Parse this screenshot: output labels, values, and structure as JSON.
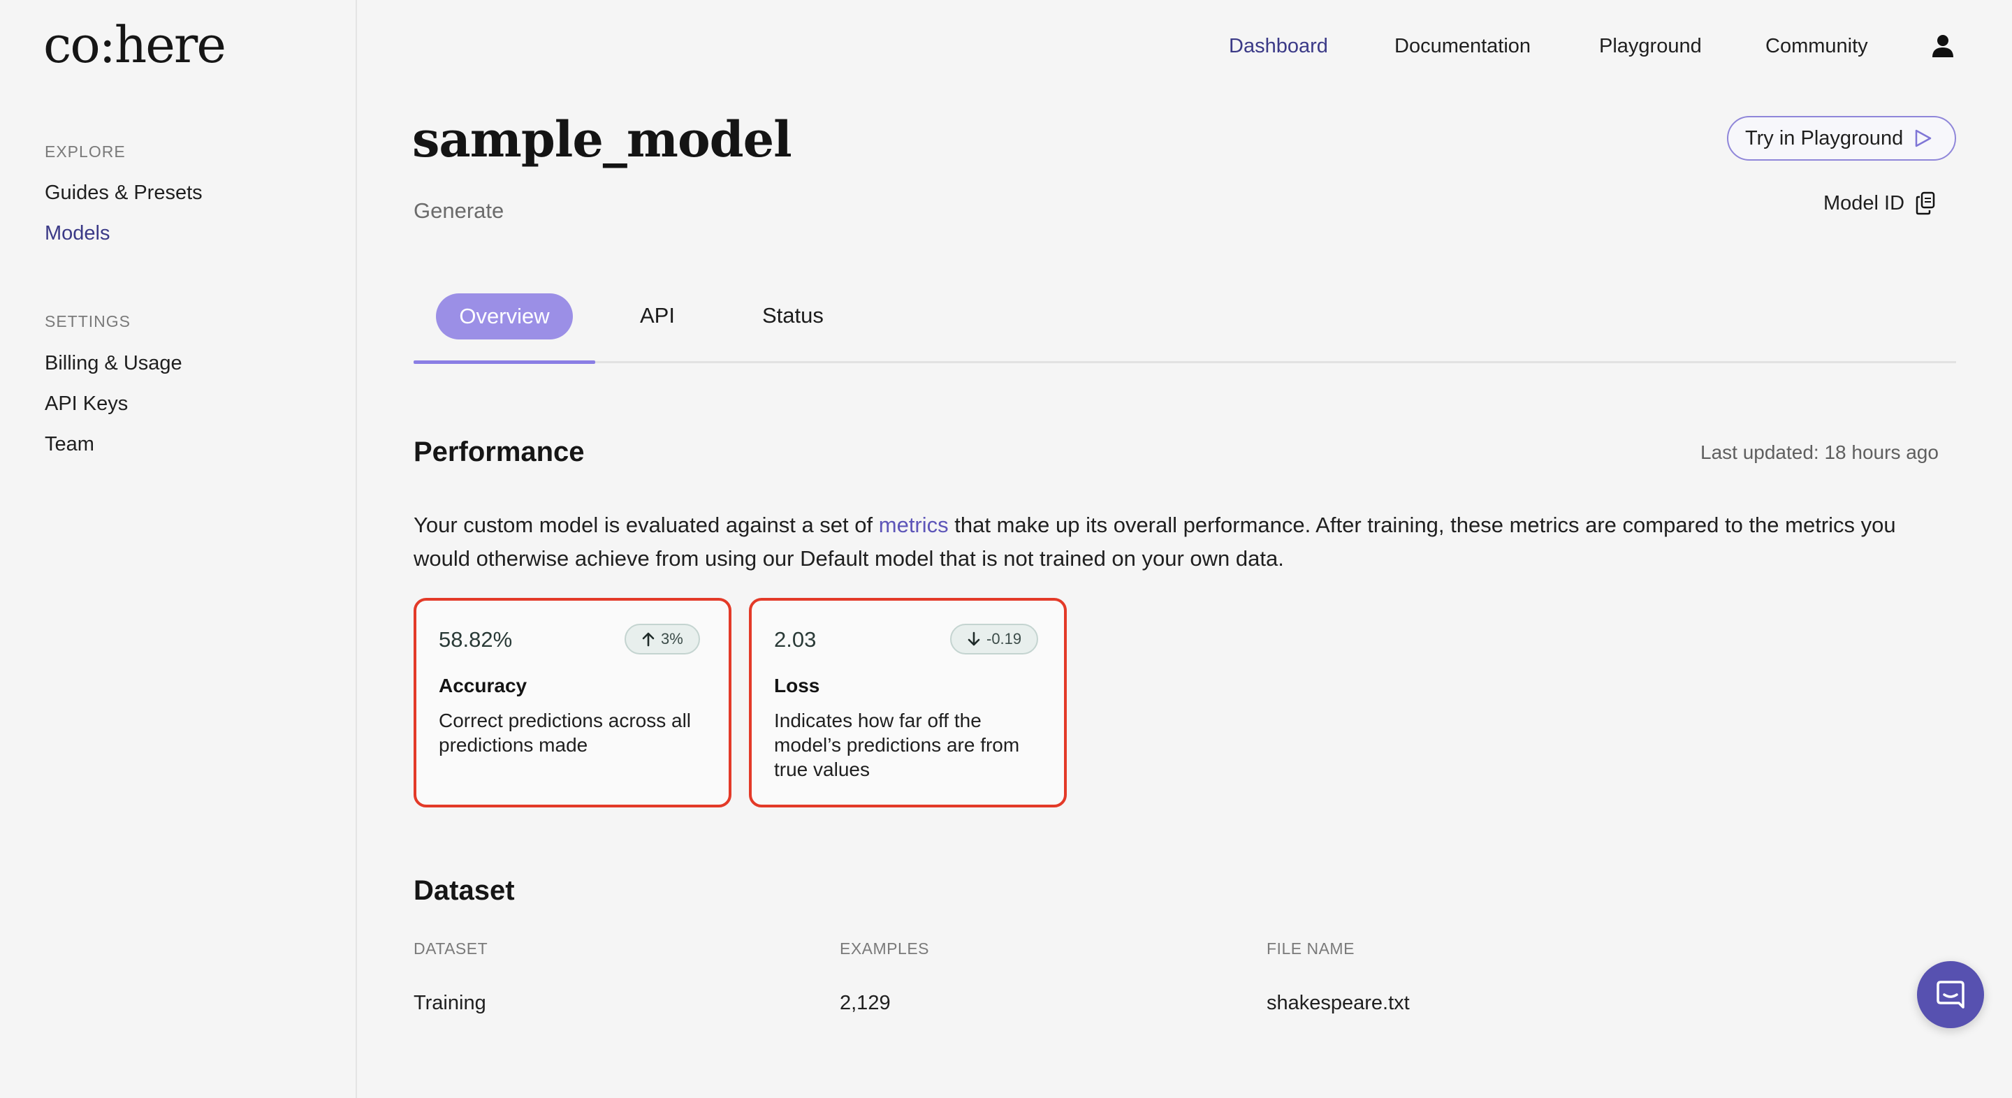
{
  "logo": {
    "text": "co:here"
  },
  "sidebar": {
    "sections": [
      {
        "label": "EXPLORE",
        "items": [
          {
            "label": "Guides & Presets"
          },
          {
            "label": "Models",
            "active": true
          }
        ]
      },
      {
        "label": "SETTINGS",
        "items": [
          {
            "label": "Billing & Usage"
          },
          {
            "label": "API Keys"
          },
          {
            "label": "Team"
          }
        ]
      }
    ]
  },
  "nav": {
    "links": [
      {
        "label": "Dashboard",
        "active": true
      },
      {
        "label": "Documentation"
      },
      {
        "label": "Playground"
      },
      {
        "label": "Community"
      }
    ],
    "user_icon": "user-icon"
  },
  "header": {
    "title": "sample_model",
    "subtitle": "Generate",
    "try_button": "Try in Playground",
    "model_id_label": "Model ID"
  },
  "tabs": [
    {
      "label": "Overview",
      "active": true
    },
    {
      "label": "API"
    },
    {
      "label": "Status"
    }
  ],
  "performance": {
    "heading": "Performance",
    "last_updated": "Last updated: 18 hours ago",
    "paragraph_before": "Your custom model is evaluated against a set of ",
    "paragraph_link": "metrics",
    "paragraph_after": " that make up its overall performance. After training, these metrics are compared to the metrics you would otherwise achieve from using our Default model that is not trained on your own data.",
    "cards": [
      {
        "value": "58.82%",
        "badge": "3%",
        "badge_icon": "arrow-up-icon",
        "name": "Accuracy",
        "description": "Correct predictions across all predictions made"
      },
      {
        "value": "2.03",
        "badge": "-0.19",
        "badge_icon": "arrow-down-icon",
        "name": "Loss",
        "description": "Indicates how far off the model’s predictions are from true values"
      }
    ]
  },
  "dataset": {
    "heading": "Dataset",
    "columns": [
      "DATASET",
      "EXAMPLES",
      "FILE NAME"
    ],
    "rows": [
      [
        "Training",
        "2,129",
        "shakespeare.txt"
      ]
    ]
  },
  "colors": {
    "accent": "#3b3a87",
    "tab_active": "#9b8fe6",
    "card_border": "#e33a28",
    "chat": "#5751b0"
  }
}
